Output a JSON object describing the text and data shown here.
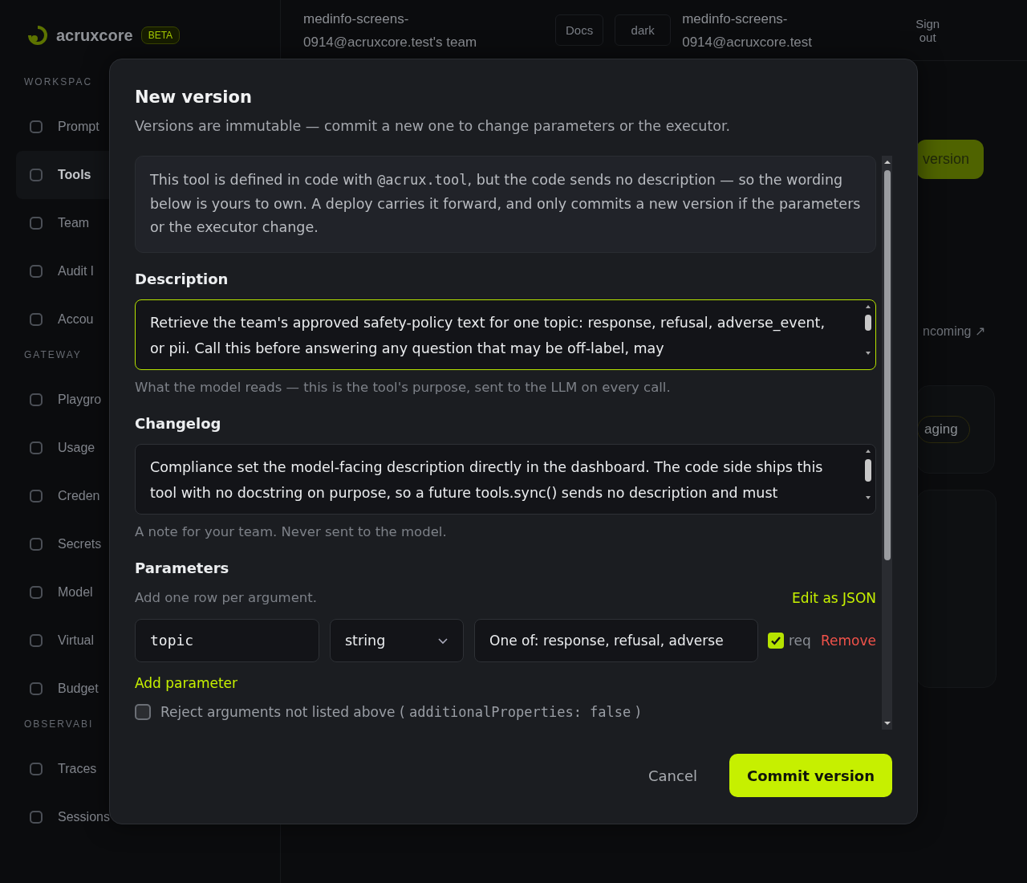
{
  "app": {
    "brand": "acruxcore",
    "badge": "BETA",
    "team": "medinfo-screens-0914@acruxcore.test's team",
    "docs": "Docs",
    "theme": "dark",
    "user": "medinfo-screens-0914@acruxcore.test",
    "sign_out": "Sign out"
  },
  "sidebar": {
    "sections": [
      {
        "heading": "WORKSPAC",
        "items": [
          {
            "label": "Prompt",
            "selected": false
          },
          {
            "label": "Tools",
            "selected": true
          },
          {
            "label": "Team",
            "selected": false
          },
          {
            "label": "Audit l",
            "selected": false
          },
          {
            "label": "Accou",
            "selected": false
          }
        ]
      },
      {
        "heading": "GATEWAY",
        "items": [
          {
            "label": "Playgro",
            "selected": false
          },
          {
            "label": "Usage",
            "selected": false
          },
          {
            "label": "Creden",
            "selected": false
          },
          {
            "label": "Secrets",
            "selected": false
          },
          {
            "label": "Model",
            "selected": false
          },
          {
            "label": "Virtual",
            "selected": false
          },
          {
            "label": "Budget",
            "selected": false
          }
        ]
      },
      {
        "heading": "OBSERVABI",
        "items": [
          {
            "label": "Traces",
            "selected": false
          },
          {
            "label": "Sessions",
            "selected": false
          }
        ]
      }
    ]
  },
  "page": {
    "new_version_button": "version",
    "link": "ncoming ↗",
    "badge": "aging"
  },
  "dialog": {
    "title": "New version",
    "subtitle": "Versions are immutable — commit a new one to change parameters or the executor.",
    "note": {
      "before": "This tool is defined in code with",
      "code": "@acrux.tool",
      "after": ", but the code sends no description — so the wording below is yours to own. A deploy carries it forward, and only commits a new version if the parameters or the executor change."
    },
    "description": {
      "label": "Description",
      "value": "Retrieve the team's approved safety-policy text for one topic: response, refusal, adverse_event, or pii. Call this before answering any question that may be off-label, may",
      "hint": "What the model reads — this is the tool's purpose, sent to the LLM on every call.",
      "focused": true
    },
    "changelog": {
      "label": "Changelog",
      "value": "Compliance set the model-facing description directly in the dashboard. The code side ships this tool with no docstring on purpose, so a future tools.sync() sends no description and must",
      "hint": "A note for your team. Never sent to the model.",
      "focused": false
    },
    "parameters": {
      "label": "Parameters",
      "hint": "Add one row per argument.",
      "edit_json": "Edit as JSON",
      "rows": [
        {
          "name": "topic",
          "type": "string",
          "description": "One of: response, refusal, adverse",
          "required_label": "req",
          "required": true,
          "remove": "Remove"
        }
      ],
      "add": "Add parameter",
      "reject_label": "Reject arguments not listed above",
      "reject_code": "additionalProperties: false",
      "reject_open": "(",
      "reject_close": ")",
      "reject": false
    },
    "cancel": "Cancel",
    "commit": "Commit version"
  }
}
